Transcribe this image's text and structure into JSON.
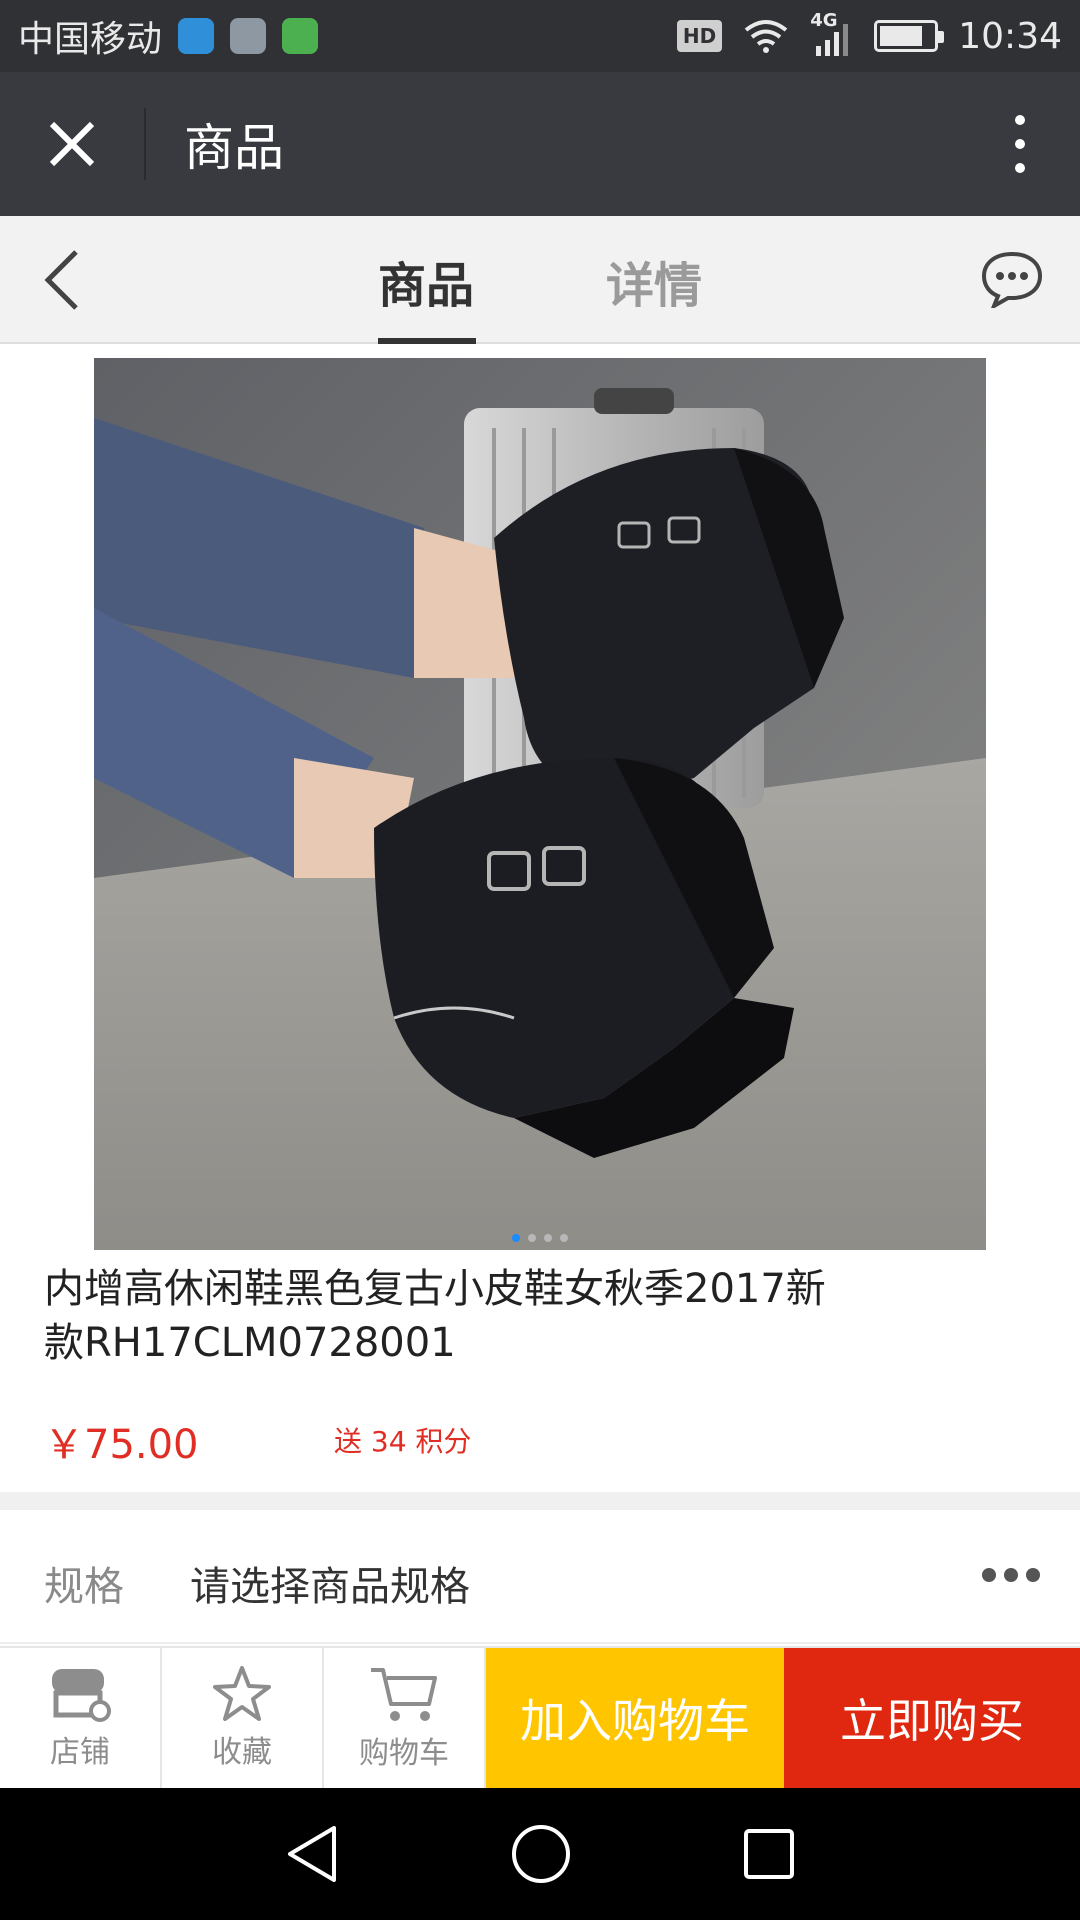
{
  "status_bar": {
    "carrier": "中国移动",
    "hd": "HD",
    "network": "4G",
    "time": "10:34",
    "battery_level": 0.8
  },
  "title_bar": {
    "title": "商品"
  },
  "tabs": {
    "goods": "商品",
    "detail": "详情",
    "active": "goods"
  },
  "product": {
    "title": "内增高休闲鞋黑色复古小皮鞋女秋季2017新款RH17CLM0728001",
    "price": "￥75.00",
    "points": "送 34 积分",
    "image_count": 4,
    "image_active_index": 0
  },
  "spec": {
    "label": "规格",
    "placeholder": "请选择商品规格"
  },
  "actions": {
    "shop": "店铺",
    "favorite": "收藏",
    "cart": "购物车",
    "add_to_cart": "加入购物车",
    "buy_now": "立即购买"
  },
  "colors": {
    "price_red": "#e02e24",
    "add_cart_yellow": "#ffc600",
    "buy_now_red": "#e02710",
    "active_dot": "#1a8cff"
  }
}
